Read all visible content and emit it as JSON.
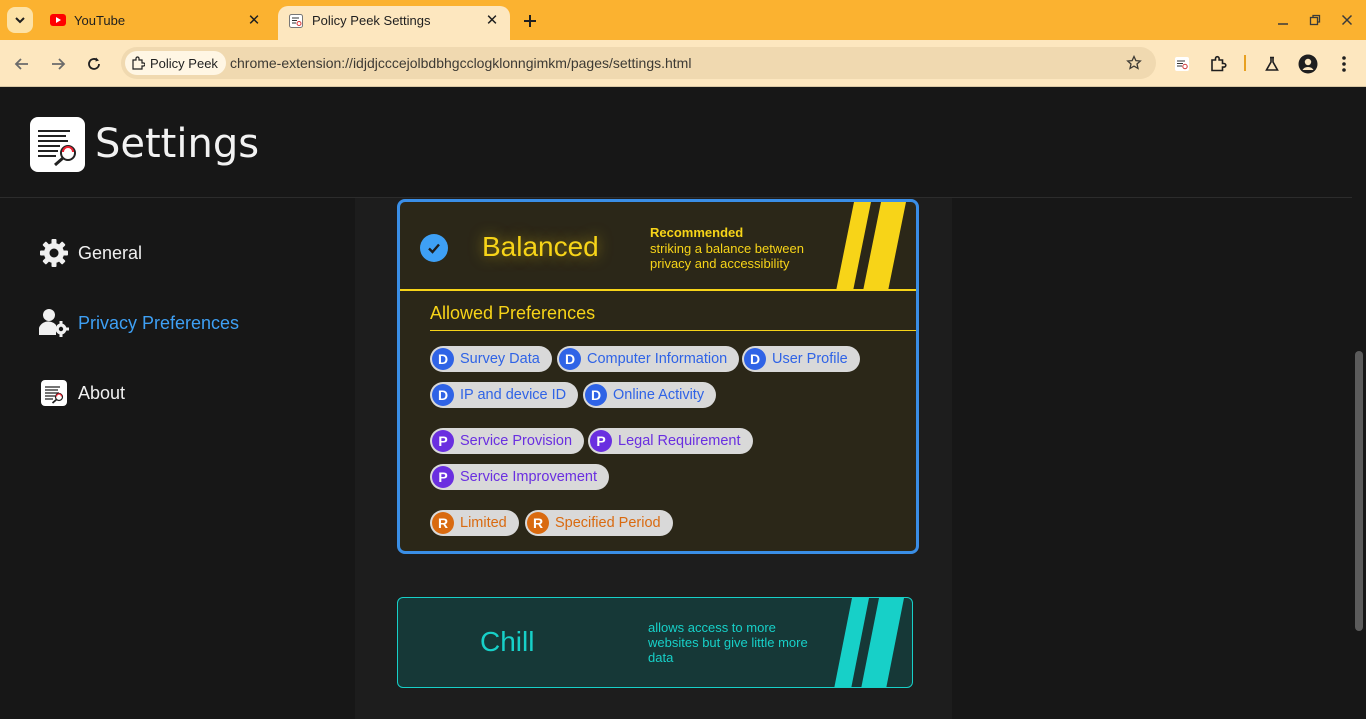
{
  "browser": {
    "tabs": [
      {
        "title": "YouTube",
        "favicon": "youtube-icon",
        "active": false
      },
      {
        "title": "Policy Peek Settings",
        "favicon": "policy-peek-icon",
        "active": true
      }
    ],
    "site_chip": "Policy Peek",
    "url": "chrome-extension://idjdjcccejolbdbhgcclogklonngimkm/pages/settings.html",
    "theme_color": "#fbb230"
  },
  "page": {
    "title": "Settings"
  },
  "sidebar": {
    "items": [
      {
        "label": "General",
        "icon": "gear-icon",
        "active": false
      },
      {
        "label": "Privacy Preferences",
        "icon": "user-gear-icon",
        "active": true
      },
      {
        "label": "About",
        "icon": "policy-peek-icon",
        "active": false
      }
    ],
    "active_color": "#3ea0f5"
  },
  "balanced": {
    "name": "Balanced",
    "recommended": "Recommended",
    "description": "striking a balance between privacy and accessibility",
    "selected": true,
    "accent": "#f7d418",
    "allowed_title": "Allowed Preferences",
    "data_prefs": [
      "Survey Data",
      "Computer Information",
      "User Profile",
      "IP and device ID",
      "Online Activity"
    ],
    "purpose_prefs": [
      "Service Provision",
      "Legal Requirement",
      "Service Improvement"
    ],
    "retention_prefs": [
      "Limited",
      "Specified Period"
    ],
    "badges": {
      "data": "D",
      "purpose": "P",
      "retention": "R"
    }
  },
  "chill": {
    "name": "Chill",
    "description": "allows access to more websites but give little more data",
    "accent": "#17d0c8"
  }
}
